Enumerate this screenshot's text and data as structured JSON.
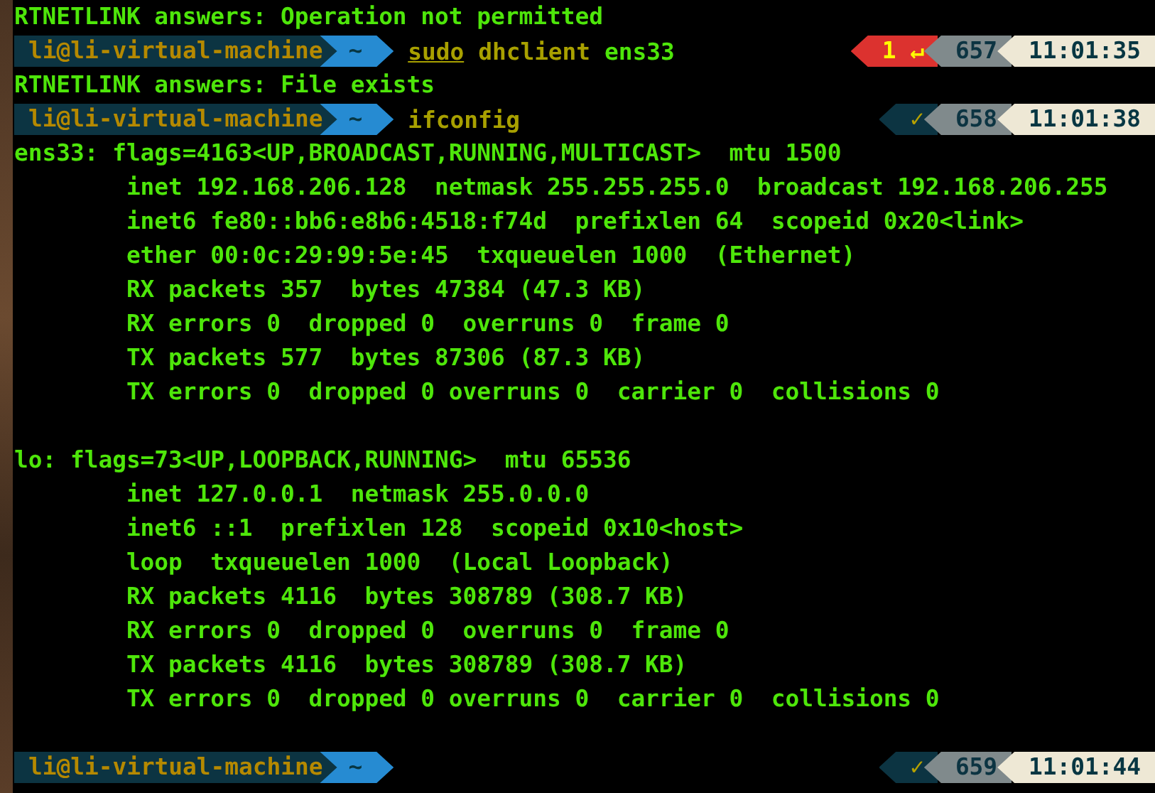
{
  "lines": [
    {
      "kind": "output",
      "text": "RTNETLINK answers: Operation not permitted"
    },
    {
      "kind": "prompt",
      "user": "li@li-virtual-machine",
      "dir": "~",
      "command": [
        {
          "text": "sudo",
          "kind": "command",
          "underlined": true
        },
        {
          "text": "dhclient",
          "kind": "command",
          "underlined": false
        },
        {
          "text": "ens33",
          "kind": "argument",
          "underlined": false
        }
      ],
      "status": {
        "kind": "error",
        "text": "1 ↵"
      },
      "history": "657",
      "time": "11:01:35"
    },
    {
      "kind": "output",
      "text": "RTNETLINK answers: File exists"
    },
    {
      "kind": "prompt",
      "user": "li@li-virtual-machine",
      "dir": "~",
      "command": [
        {
          "text": "ifconfig",
          "kind": "command",
          "underlined": false
        }
      ],
      "status": {
        "kind": "ok",
        "text": "✓"
      },
      "history": "658",
      "time": "11:01:38"
    },
    {
      "kind": "output",
      "text": "ens33: flags=4163<UP,BROADCAST,RUNNING,MULTICAST>  mtu 1500"
    },
    {
      "kind": "output",
      "text": "        inet 192.168.206.128  netmask 255.255.255.0  broadcast 192.168.206.255"
    },
    {
      "kind": "output",
      "text": "        inet6 fe80::bb6:e8b6:4518:f74d  prefixlen 64  scopeid 0x20<link>"
    },
    {
      "kind": "output",
      "text": "        ether 00:0c:29:99:5e:45  txqueuelen 1000  (Ethernet)"
    },
    {
      "kind": "output",
      "text": "        RX packets 357  bytes 47384 (47.3 KB)"
    },
    {
      "kind": "output",
      "text": "        RX errors 0  dropped 0  overruns 0  frame 0"
    },
    {
      "kind": "output",
      "text": "        TX packets 577  bytes 87306 (87.3 KB)"
    },
    {
      "kind": "output",
      "text": "        TX errors 0  dropped 0 overruns 0  carrier 0  collisions 0"
    },
    {
      "kind": "blank"
    },
    {
      "kind": "output",
      "text": "lo: flags=73<UP,LOOPBACK,RUNNING>  mtu 65536"
    },
    {
      "kind": "output",
      "text": "        inet 127.0.0.1  netmask 255.0.0.0"
    },
    {
      "kind": "output",
      "text": "        inet6 ::1  prefixlen 128  scopeid 0x10<host>"
    },
    {
      "kind": "output",
      "text": "        loop  txqueuelen 1000  (Local Loopback)"
    },
    {
      "kind": "output",
      "text": "        RX packets 4116  bytes 308789 (308.7 KB)"
    },
    {
      "kind": "output",
      "text": "        RX errors 0  dropped 0  overruns 0  frame 0"
    },
    {
      "kind": "output",
      "text": "        TX packets 4116  bytes 308789 (308.7 KB)"
    },
    {
      "kind": "output",
      "text": "        TX errors 0  dropped 0 overruns 0  carrier 0  collisions 0"
    },
    {
      "kind": "blank"
    },
    {
      "kind": "prompt",
      "user": "li@li-virtual-machine",
      "dir": "~",
      "status": {
        "kind": "ok",
        "text": "✓"
      },
      "history": "659",
      "time": "11:01:44"
    }
  ]
}
